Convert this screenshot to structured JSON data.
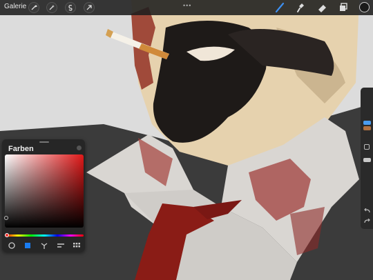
{
  "toolbar": {
    "gallery_label": "Galerie",
    "more_glyph": "•••",
    "left_tools": [
      "wrench-icon",
      "magic-wand-icon",
      "selection-icon",
      "transform-arrow-icon"
    ],
    "right_tools": [
      "brush-icon",
      "smudge-icon",
      "eraser-icon",
      "layers-icon"
    ],
    "active_tool": "brush-icon",
    "current_color": "#1b1b1b"
  },
  "sidebar": {
    "brush_size_level": 0.25,
    "opacity_level": 0.5,
    "buttons": [
      "modify-square-icon",
      "undo-icon",
      "redo-icon"
    ],
    "accent_color": "#4a9cf0"
  },
  "colors_panel": {
    "title": "Farben",
    "picker_hue": "#e01818",
    "modes": [
      "disc-icon",
      "classic-icon",
      "harmony-icon",
      "value-icon",
      "palettes-icon"
    ],
    "active_mode": "classic-icon",
    "accent_color": "#1a7cf0"
  },
  "artwork": {
    "background": "#dcdcdc",
    "skin": "#e8d4b0",
    "beard": "#1e1a18",
    "jacket": "#3a3a3a",
    "shirt": "#d9d6d2",
    "blood": "#8e1e1a",
    "tie": "#8a1c16"
  }
}
